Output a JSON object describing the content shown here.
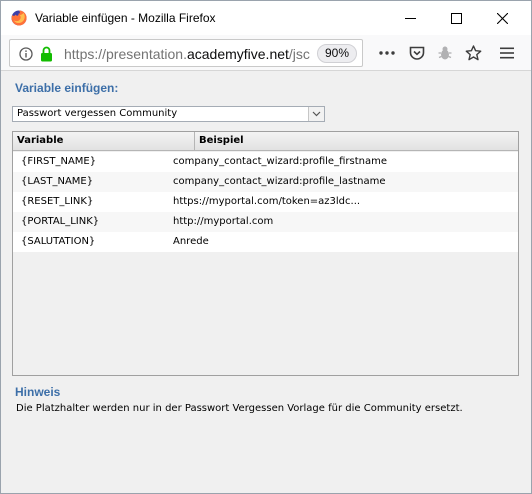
{
  "window": {
    "title": "Variable einfügen - Mozilla Firefox"
  },
  "urlbar": {
    "url_prefix": "https://presentation.",
    "url_domain": "academyfive.net",
    "url_suffix": "/jsc",
    "zoom": "90%"
  },
  "dialog": {
    "heading": "Variable einfügen:",
    "select_value": "Passwort vergessen Community",
    "columns": [
      "Variable",
      "Beispiel"
    ],
    "rows": [
      {
        "variable": "{FIRST_NAME}",
        "example": "company_contact_wizard:profile_firstname"
      },
      {
        "variable": "{LAST_NAME}",
        "example": "company_contact_wizard:profile_lastname"
      },
      {
        "variable": "{RESET_LINK}",
        "example": "https://myportal.com/token=az3ldc..."
      },
      {
        "variable": "{PORTAL_LINK}",
        "example": "http://myportal.com"
      },
      {
        "variable": "{SALUTATION}",
        "example": "Anrede"
      }
    ],
    "hint_title": "Hinweis",
    "hint_text": "Die Platzhalter werden nur in der Passwort Vergessen Vorlage für die Community ersetzt."
  },
  "colors": {
    "accent_heading": "#3d6fa8",
    "background": "#f0f0f0",
    "lock_green": "#12bc00"
  },
  "icons": [
    "firefox-logo",
    "minimize-icon",
    "maximize-icon",
    "close-icon",
    "info-icon",
    "lock-icon",
    "more-icon",
    "pocket-icon",
    "extension-icon",
    "bookmark-star-icon",
    "menu-icon",
    "dropdown-arrow-icon"
  ]
}
